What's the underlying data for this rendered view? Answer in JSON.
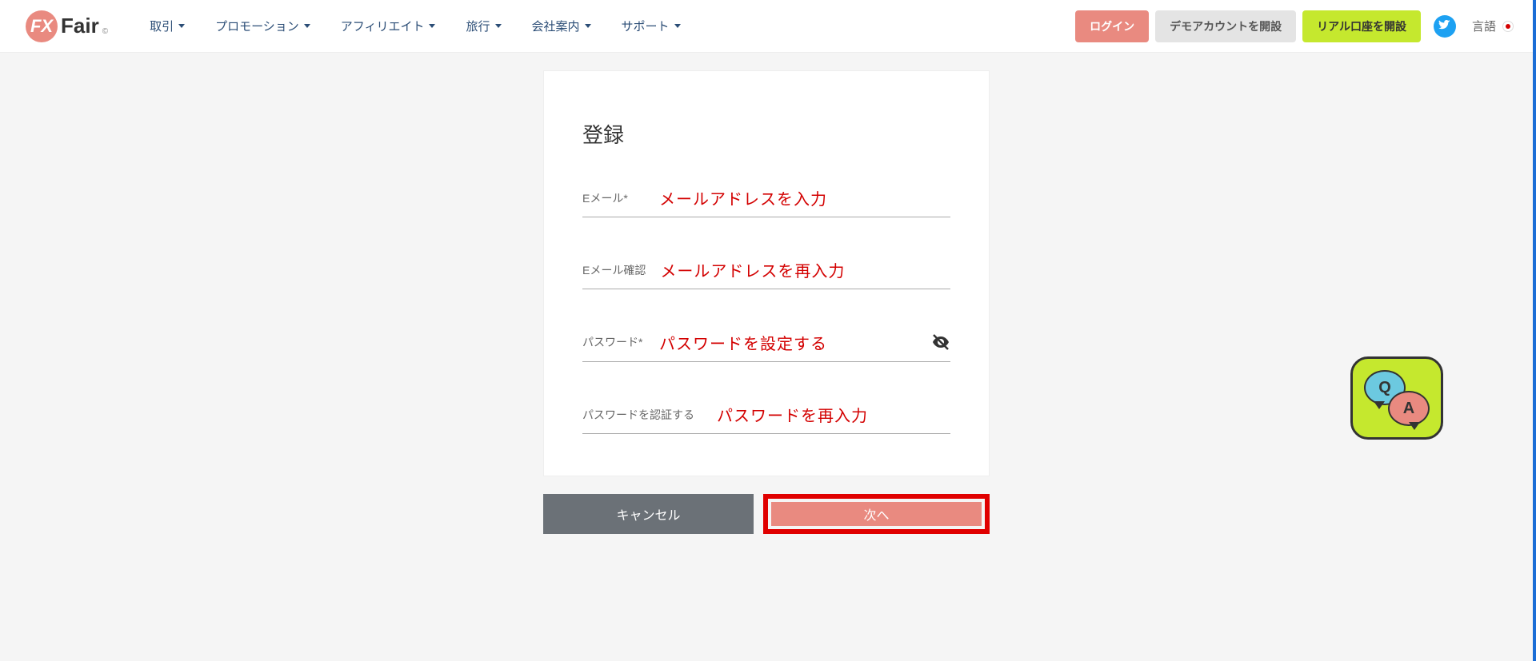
{
  "brand": {
    "mark": "FX",
    "text": "Fair",
    "suffix": "©"
  },
  "nav": {
    "items": [
      {
        "label": "取引"
      },
      {
        "label": "プロモーション"
      },
      {
        "label": "アフィリエイト"
      },
      {
        "label": "旅行"
      },
      {
        "label": "会社案内"
      },
      {
        "label": "サポート"
      }
    ]
  },
  "header_buttons": {
    "login": "ログイン",
    "demo": "デモアカウントを開設",
    "real": "リアル口座を開設",
    "language": "言語"
  },
  "form": {
    "title": "登録",
    "email": {
      "label": "Eメール*",
      "value": "メールアドレスを入力"
    },
    "email_confirm": {
      "label": "Eメール確認",
      "value": "メールアドレスを再入力"
    },
    "password": {
      "label": "パスワード*",
      "value": "パスワードを設定する"
    },
    "password_confirm": {
      "label": "パスワードを認証する",
      "value": "パスワードを再入力"
    }
  },
  "footer_buttons": {
    "cancel": "キャンセル",
    "next": "次へ"
  },
  "qa": {
    "q": "Q",
    "a": "A"
  }
}
